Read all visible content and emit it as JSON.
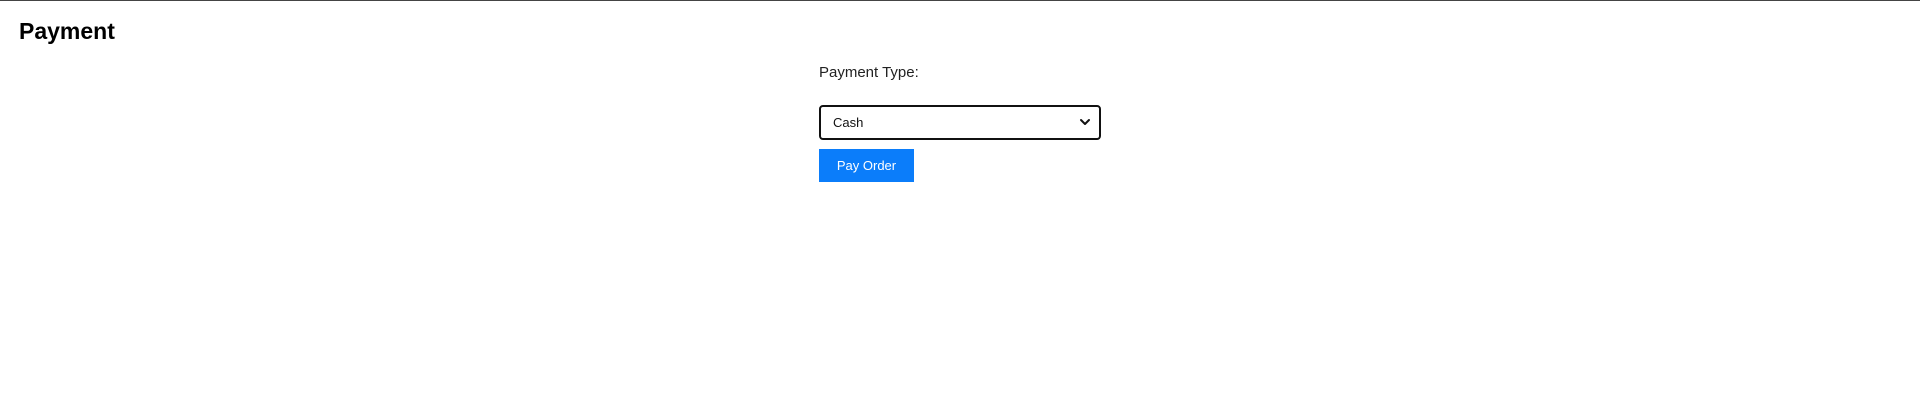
{
  "header": {
    "title": "Payment"
  },
  "form": {
    "payment_type_label": "Payment Type:",
    "payment_type_selected": "Cash",
    "pay_button_label": "Pay Order"
  },
  "colors": {
    "pay_button_bg": "#0b7dfa",
    "select_border": "#111111"
  },
  "icons": {
    "select_chevron": "chevron-down-icon"
  }
}
